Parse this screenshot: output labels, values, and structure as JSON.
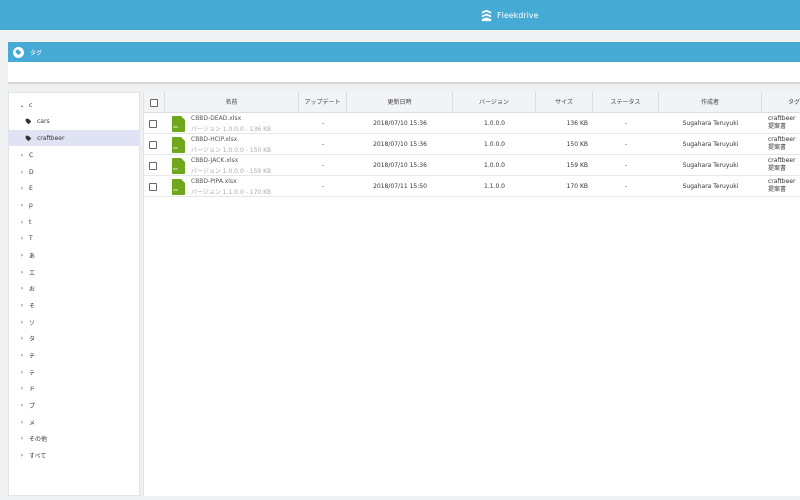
{
  "app": {
    "brand": "Fleekdrive"
  },
  "tag_header": {
    "title": "タグ"
  },
  "tree": [
    {
      "label": "c",
      "expanded": true,
      "children": [
        {
          "label": "cars",
          "selected": false
        },
        {
          "label": "craftbeer",
          "selected": true
        }
      ]
    },
    {
      "label": "C"
    },
    {
      "label": "D"
    },
    {
      "label": "E"
    },
    {
      "label": "p"
    },
    {
      "label": "t"
    },
    {
      "label": "T"
    },
    {
      "label": "あ"
    },
    {
      "label": "エ"
    },
    {
      "label": "お"
    },
    {
      "label": "そ"
    },
    {
      "label": "ソ"
    },
    {
      "label": "タ"
    },
    {
      "label": "チ"
    },
    {
      "label": "テ"
    },
    {
      "label": "ド"
    },
    {
      "label": "プ"
    },
    {
      "label": "メ"
    },
    {
      "label": "その他"
    },
    {
      "label": "すべて"
    }
  ],
  "table": {
    "columns": [
      "名前",
      "アップデート",
      "更新日時",
      "バージョン",
      "サイズ",
      "ステータス",
      "作成者",
      "タグ"
    ],
    "rows": [
      {
        "name": "CBBD-DEAD.xlsx",
        "version_line": "バージョン 1.0.0.0 - 136 KB",
        "update": "-",
        "updated": "2018/07/10 15:36",
        "version": "1.0.0.0",
        "size": "136 KB",
        "status": "-",
        "creator": "Sugahara Teruyuki",
        "tag1": "craftbeer",
        "tag2": "提案書"
      },
      {
        "name": "CBBD-HCIP.xlsx",
        "version_line": "バージョン 1.0.0.0 - 150 KB",
        "update": "-",
        "updated": "2018/07/10 15:36",
        "version": "1.0.0.0",
        "size": "150 KB",
        "status": "-",
        "creator": "Sugahara Teruyuki",
        "tag1": "craftbeer",
        "tag2": "提案書"
      },
      {
        "name": "CBBD-JACK.xlsx",
        "version_line": "バージョン 1.0.0.0 - 159 KB",
        "update": "-",
        "updated": "2018/07/10 15:36",
        "version": "1.0.0.0",
        "size": "159 KB",
        "status": "-",
        "creator": "Sugahara Teruyuki",
        "tag1": "craftbeer",
        "tag2": "提案書"
      },
      {
        "name": "CBBD-PIPA.xlsx",
        "version_line": "バージョン 1.1.0.0 - 170 KB",
        "update": "-",
        "updated": "2018/07/11 15:50",
        "version": "1.1.0.0",
        "size": "170 KB",
        "status": "-",
        "creator": "Sugahara Teruyuki",
        "tag1": "craftbeer",
        "tag2": "提案書"
      }
    ]
  },
  "file_icon_text": "xls",
  "colors": {
    "header": "#45abd4",
    "selected": "#dfe3f3",
    "excel_icon": "#6fa71c"
  }
}
